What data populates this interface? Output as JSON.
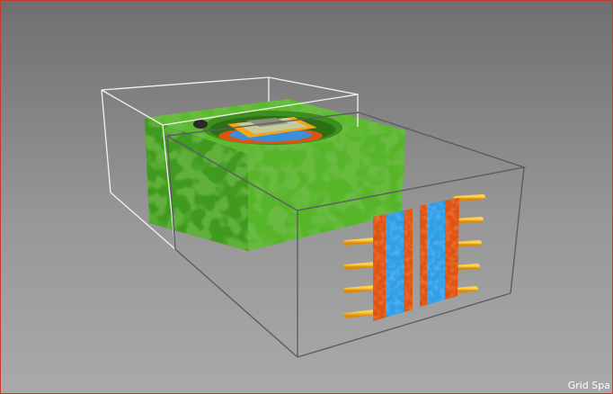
{
  "viewport": {
    "status_label": "Grid Spa",
    "border_color": "#c23a32"
  },
  "scene": {
    "objects": [
      {
        "name": "green-housing-block",
        "color": "#4ea82a"
      },
      {
        "name": "white-bounding-box",
        "color": "#ffffff"
      },
      {
        "name": "gray-bounding-box",
        "color": "#5c5c66"
      },
      {
        "name": "top-cavity-component",
        "color": "#3a8fd8"
      },
      {
        "name": "orange-plate-left",
        "color": "#e0520f"
      },
      {
        "name": "blue-plate-left",
        "color": "#2f9ee8"
      },
      {
        "name": "orange-plate-right",
        "color": "#e0520f"
      },
      {
        "name": "blue-plate-right",
        "color": "#2f9ee8"
      },
      {
        "name": "terminal-pins",
        "color": "#f2a81d"
      }
    ]
  }
}
